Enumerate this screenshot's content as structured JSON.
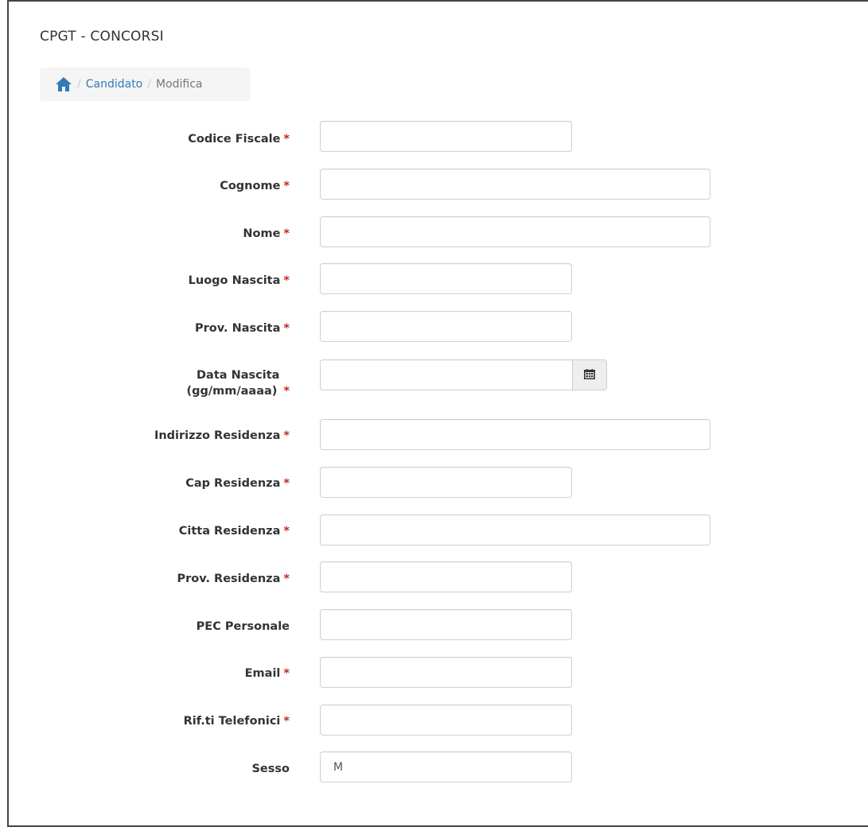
{
  "app": {
    "title": "CPGT - CONCORSI"
  },
  "breadcrumb": {
    "home_icon": "home-icon",
    "separator": "/",
    "items": [
      {
        "label": "Candidato"
      },
      {
        "label": "Modifica"
      }
    ]
  },
  "form": {
    "required_marker": "*",
    "fields": {
      "codice_fiscale": {
        "label": "Codice Fiscale",
        "value": ""
      },
      "cognome": {
        "label": "Cognome",
        "value": ""
      },
      "nome": {
        "label": "Nome",
        "value": ""
      },
      "luogo_nascita": {
        "label": "Luogo Nascita",
        "value": ""
      },
      "prov_nascita": {
        "label": "Prov. Nascita",
        "value": ""
      },
      "data_nascita": {
        "label_line1": "Data Nascita",
        "label_line2": "(gg/mm/aaaa)",
        "value": "",
        "icon": "calendar-icon"
      },
      "indirizzo_residenza": {
        "label": "Indirizzo Residenza",
        "value": ""
      },
      "cap_residenza": {
        "label": "Cap Residenza",
        "value": ""
      },
      "citta_residenza": {
        "label": "Citta Residenza",
        "value": ""
      },
      "prov_residenza": {
        "label": "Prov. Residenza",
        "value": ""
      },
      "pec_personale": {
        "label": "PEC Personale",
        "value": ""
      },
      "email": {
        "label": "Email",
        "value": ""
      },
      "rif_telefonici": {
        "label": "Rif.ti Telefonici",
        "value": ""
      },
      "sesso": {
        "label": "Sesso",
        "value": "M"
      }
    }
  },
  "colors": {
    "link": "#337ab7",
    "required": "#cc2222",
    "breadcrumb_bg": "#f5f5f5",
    "input_border": "#cfcfcf",
    "addon_bg": "#eeeeee"
  }
}
